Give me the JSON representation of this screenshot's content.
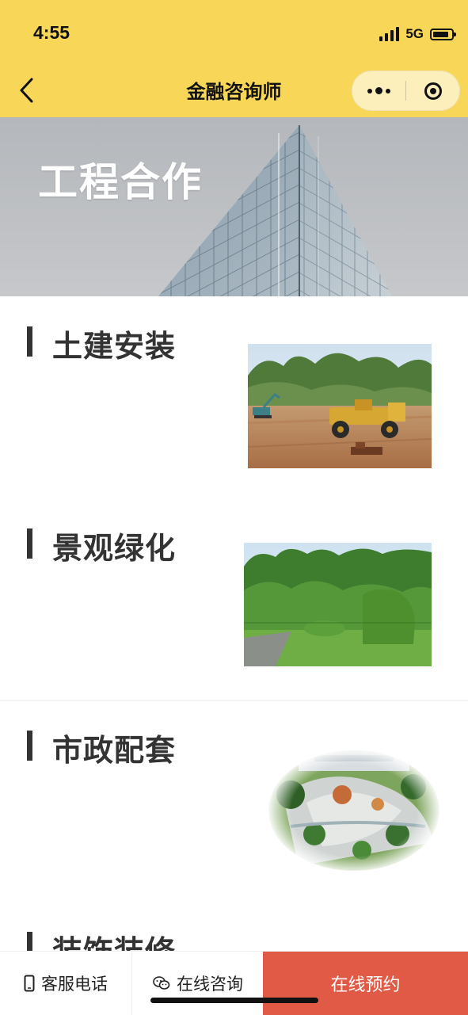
{
  "status_bar": {
    "time": "4:55",
    "network": "5G"
  },
  "nav": {
    "title": "金融咨询师"
  },
  "banner": {
    "title": "工程合作"
  },
  "sections": [
    {
      "title": "土建安装"
    },
    {
      "title": "景观绿化"
    },
    {
      "title": "市政配套"
    },
    {
      "title": "装饰装修"
    }
  ],
  "bottom_bar": {
    "phone_label": "客服电话",
    "chat_label": "在线咨询",
    "book_label": "在线预约"
  },
  "colors": {
    "header": "#f8d758",
    "accent_button": "#e05a45",
    "section_bar": "#333333"
  }
}
